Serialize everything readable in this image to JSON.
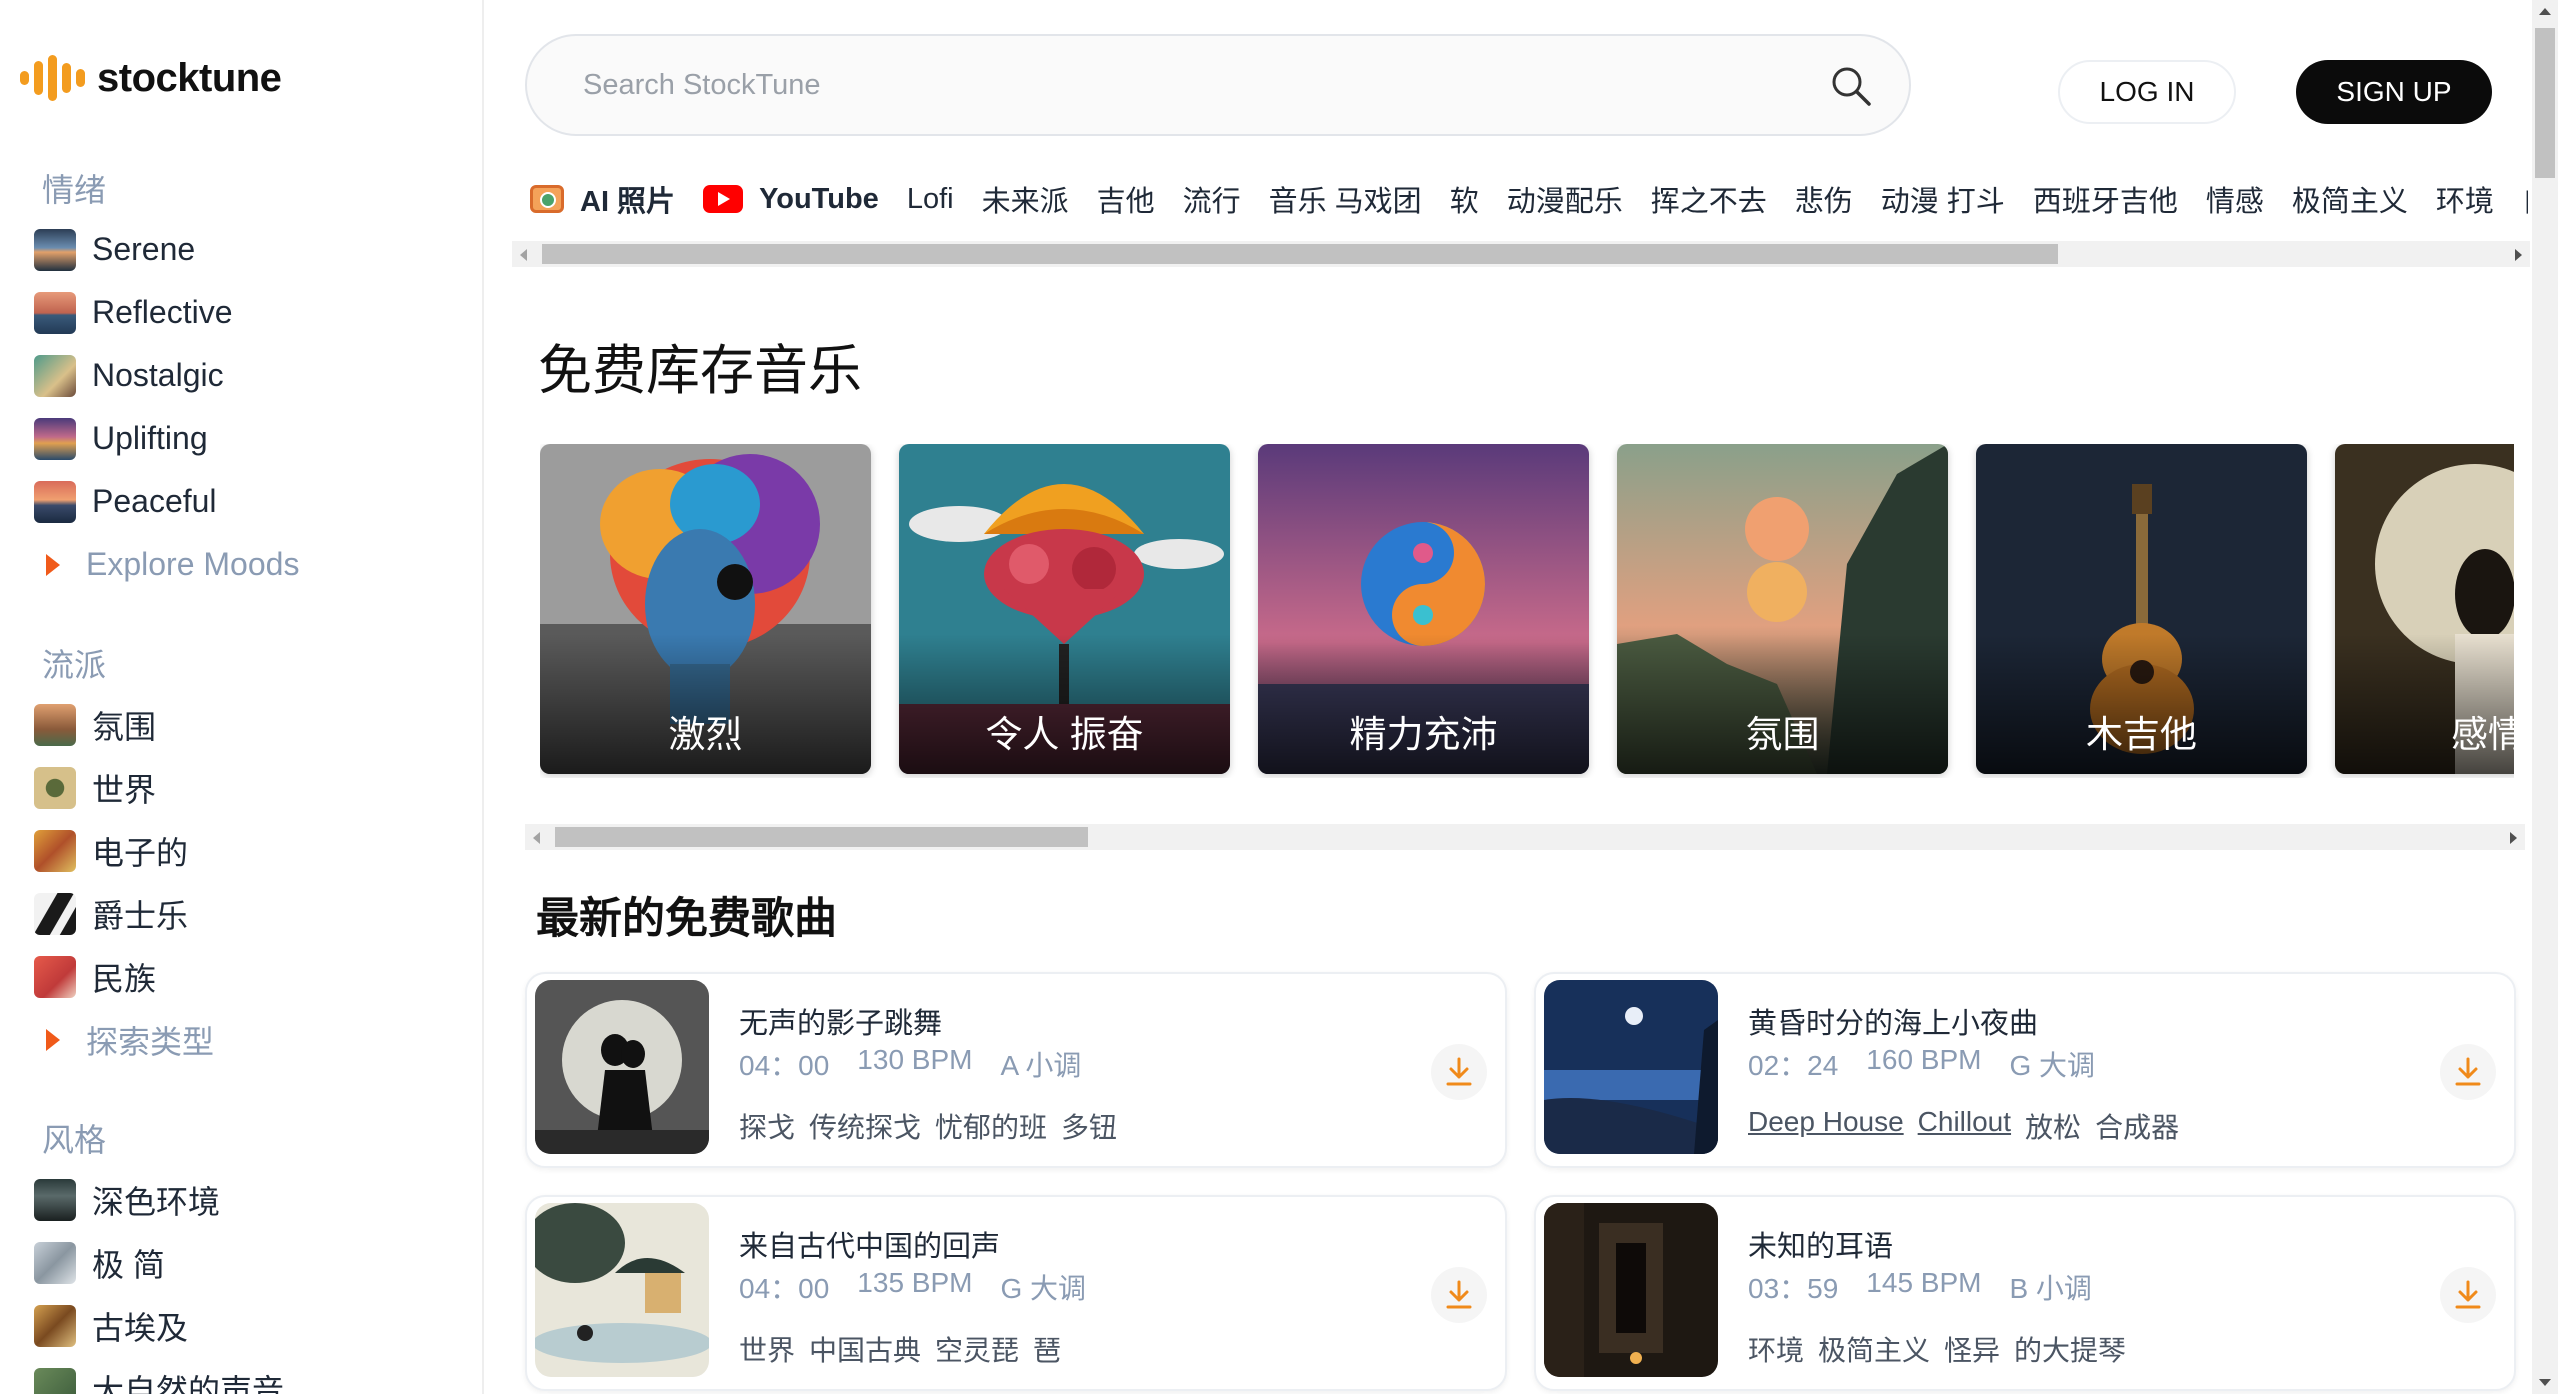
{
  "brand": {
    "name": "stocktune",
    "accent": "#f39c1f"
  },
  "sidebar": {
    "moods": {
      "heading": "情绪",
      "items": [
        {
          "label": "Serene",
          "color": "#4b6a88"
        },
        {
          "label": "Reflective",
          "color": "#c0634f"
        },
        {
          "label": "Nostalgic",
          "color": "#5b8f7b"
        },
        {
          "label": "Uplifting",
          "color": "#6b4f8f"
        },
        {
          "label": "Peaceful",
          "color": "#b3574a"
        }
      ],
      "explore": "Explore Moods"
    },
    "genres": {
      "heading": "流派",
      "items": [
        {
          "label": "氛围",
          "color": "#c47a4a"
        },
        {
          "label": "世界",
          "color": "#8a7a3a"
        },
        {
          "label": "电子的",
          "color": "#d08a3a"
        },
        {
          "label": "爵士乐",
          "color": "#2a2a2a"
        },
        {
          "label": "民族",
          "color": "#d84a3a"
        }
      ],
      "explore": "探索类型"
    },
    "styles": {
      "heading": "风格",
      "items": [
        {
          "label": "深色环境",
          "color": "#3a4a4a"
        },
        {
          "label": "极 简",
          "color": "#9aa6b0"
        },
        {
          "label": "古埃及",
          "color": "#b07a3a"
        },
        {
          "label": "大自然的声音",
          "color": "#5a7a4a"
        }
      ]
    }
  },
  "header": {
    "search_placeholder": "Search StockTune",
    "login": "LOG IN",
    "signup": "SIGN UP"
  },
  "tags": [
    "AI 照片",
    "YouTube",
    "Lofi",
    "未来派",
    "吉他",
    "流行",
    "音乐 马戏团",
    "软",
    "动漫配乐",
    "挥之不去",
    "悲伤",
    "动漫 打斗",
    "西班牙吉他",
    "情感",
    "极简主义",
    "环境",
    "自由"
  ],
  "main": {
    "heading": "免费库存音乐",
    "cards": [
      {
        "label": "激烈",
        "bg": "#8c8c8c"
      },
      {
        "label": "令人 振奋",
        "bg": "#2b7a8a"
      },
      {
        "label": "精力充沛",
        "bg": "#6a4d7a"
      },
      {
        "label": "氛围",
        "bg": "#9a8a6a"
      },
      {
        "label": "木吉他",
        "bg": "#1f2a3a"
      },
      {
        "label": "感情",
        "bg": "#3a3020"
      }
    ],
    "latest_heading": "最新的免费歌曲",
    "songs": [
      {
        "title": "无声的影子跳舞",
        "duration": "04：00",
        "bpm": "130 BPM",
        "key": "A 小调",
        "tags": [
          "探戈",
          "传统探戈",
          "忧郁的班",
          "多钮"
        ]
      },
      {
        "title": "黄昏时分的海上小夜曲",
        "duration": "02：24",
        "bpm": "160 BPM",
        "key": "G 大调",
        "tags": [
          "Deep House",
          "Chillout",
          "放松",
          "合成器"
        ]
      },
      {
        "title": "来自古代中国的回声",
        "duration": "04：00",
        "bpm": "135 BPM",
        "key": "G 大调",
        "tags": [
          "世界",
          "中国古典",
          "空灵琵",
          "琶"
        ]
      },
      {
        "title": "未知的耳语",
        "duration": "03：59",
        "bpm": "145 BPM",
        "key": "B 小调",
        "tags": [
          "环境",
          "极简主义",
          "怪异",
          "的大提琴"
        ]
      }
    ]
  }
}
